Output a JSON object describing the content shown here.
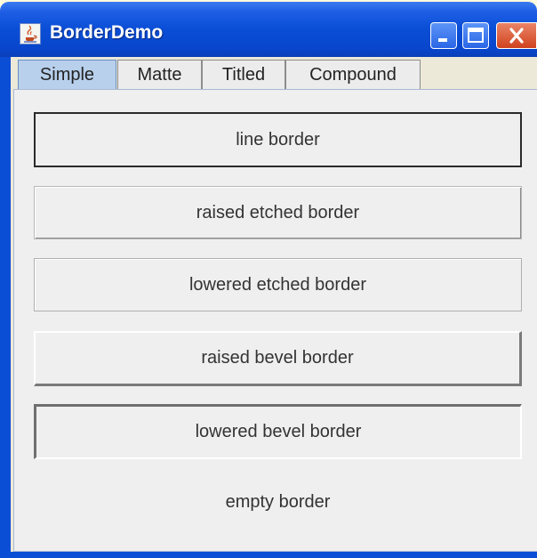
{
  "window": {
    "title": "BorderDemo"
  },
  "tabs": [
    {
      "label": "Simple",
      "active": true
    },
    {
      "label": "Matte",
      "active": false
    },
    {
      "label": "Titled",
      "active": false
    },
    {
      "label": "Compound",
      "active": false
    }
  ],
  "borders": [
    "line border",
    "raised etched border",
    "lowered etched border",
    "raised bevel border",
    "lowered bevel border",
    "empty border"
  ],
  "icons": {
    "app": "java-cup-icon",
    "minimize": "minimize-icon",
    "maximize": "maximize-icon",
    "close": "close-icon"
  },
  "colors": {
    "titlebar": "#0a4ed6",
    "close_button": "#d0421e",
    "active_tab": "#b8d0ec"
  }
}
